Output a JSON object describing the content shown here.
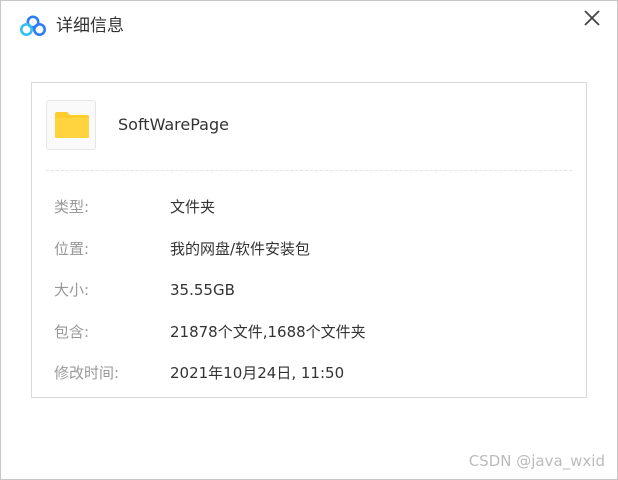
{
  "window": {
    "title": "详细信息",
    "logo_icon": "baidu-netdisk-logo-icon",
    "close_icon": "close-icon"
  },
  "item": {
    "icon": "folder-icon",
    "name": "SoftWarePage"
  },
  "details": [
    {
      "label": "类型:",
      "value": "文件夹"
    },
    {
      "label": "位置:",
      "value": "我的网盘/软件安装包"
    },
    {
      "label": "大小:",
      "value": "35.55GB"
    },
    {
      "label": "包含:",
      "value": "21878个文件,1688个文件夹"
    },
    {
      "label": "修改时间:",
      "value": "2021年10月24日, 11:50"
    }
  ],
  "watermark": "CSDN @java_wxid",
  "colors": {
    "logo_blue": "#2f7cf6",
    "logo_cyan": "#34c0f0",
    "folder_yellow": "#ffcd2e",
    "label_gray": "#999999",
    "text_dark": "#333333"
  }
}
